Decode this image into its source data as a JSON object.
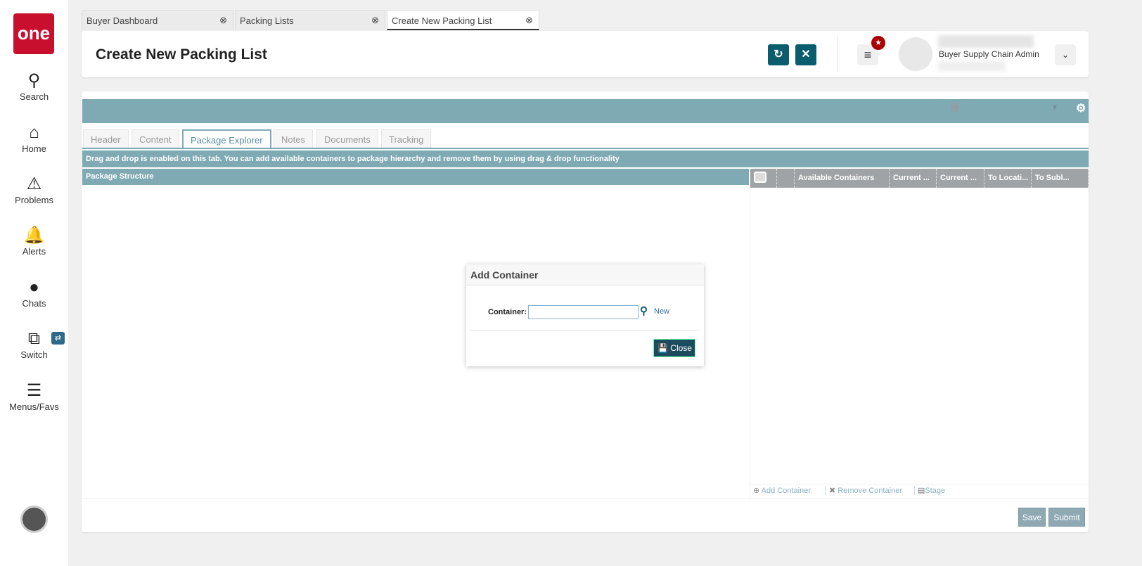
{
  "sidebar": {
    "logo": "one",
    "items": [
      {
        "label": "Search",
        "icon": "search-icon"
      },
      {
        "label": "Home",
        "icon": "home-icon"
      },
      {
        "label": "Problems",
        "icon": "warning-icon"
      },
      {
        "label": "Alerts",
        "icon": "bell-icon"
      },
      {
        "label": "Chats",
        "icon": "chat-icon"
      },
      {
        "label": "Switch",
        "icon": "switch-icon"
      },
      {
        "label": "Menus/Favs",
        "icon": "menu-icon"
      }
    ]
  },
  "tabs": [
    {
      "label": "Buyer Dashboard"
    },
    {
      "label": "Packing Lists"
    },
    {
      "label": "Create New Packing List"
    }
  ],
  "header": {
    "title": "Create New Packing List",
    "user_role": "Buyer Supply Chain Admin"
  },
  "page_tabs": [
    "Header",
    "Content",
    "Package Explorer",
    "Notes",
    "Documents",
    "Tracking"
  ],
  "info_text": "Drag and drop is enabled on this tab. You can add available containers to package hierarchy and remove them by using drag & drop functionality",
  "package_structure": "Package Structure",
  "grid": {
    "columns": [
      "Available Containers",
      "Current ...",
      "Current ...",
      "To Locati...",
      "To Subl..."
    ]
  },
  "toolbar": {
    "add": "Add Container",
    "remove": "Remove Container",
    "stage": "Stage"
  },
  "dialog": {
    "title": "Add Container",
    "label": "Container:",
    "value": "",
    "new": "New",
    "close": "Close"
  },
  "footer": {
    "save": "Save",
    "submit": "Submit"
  }
}
